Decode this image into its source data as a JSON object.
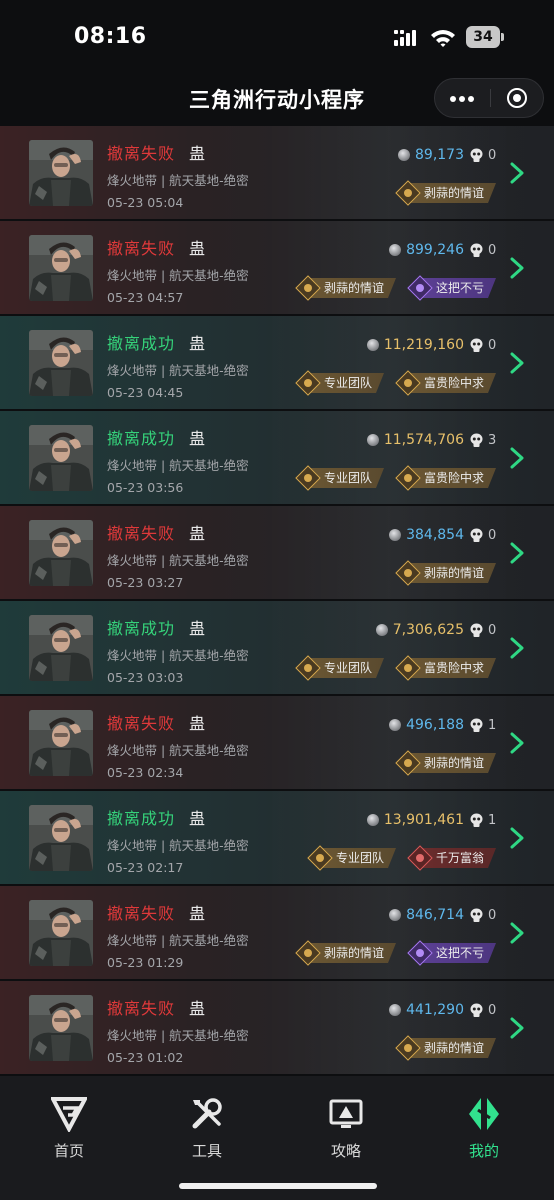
{
  "status_bar": {
    "time": "08:16",
    "battery": "34"
  },
  "nav": {
    "title": "三角洲行动小程序"
  },
  "icons": {
    "coin": "coin-icon",
    "kills": "skull-icon",
    "tag": "badge-diamond-icon",
    "row": "chevron-right-icon"
  },
  "colors": {
    "fail": "#e0393a",
    "success": "#35d27a",
    "value_blue": "#5fb8ec",
    "value_gold": "#e7c06a",
    "accent": "#32e28e"
  },
  "records": [
    {
      "status": "fail",
      "result": "撤离失败",
      "player": "蛊",
      "map": "烽火地带 | 航天基地-绝密",
      "time": "05-23 05:04",
      "value": "89,173",
      "value_color": "blue",
      "kills": "0",
      "tags": [
        {
          "label": "剥蒜的情谊",
          "style": "gold"
        }
      ]
    },
    {
      "status": "fail",
      "result": "撤离失败",
      "player": "蛊",
      "map": "烽火地带 | 航天基地-绝密",
      "time": "05-23 04:57",
      "value": "899,246",
      "value_color": "blue",
      "kills": "0",
      "tags": [
        {
          "label": "剥蒜的情谊",
          "style": "gold"
        },
        {
          "label": "这把不亏",
          "style": "purple"
        }
      ]
    },
    {
      "status": "success",
      "result": "撤离成功",
      "player": "蛊",
      "map": "烽火地带 | 航天基地-绝密",
      "time": "05-23 04:45",
      "value": "11,219,160",
      "value_color": "gold",
      "kills": "0",
      "tags": [
        {
          "label": "专业团队",
          "style": "gold"
        },
        {
          "label": "富贵险中求",
          "style": "gold"
        }
      ]
    },
    {
      "status": "success",
      "result": "撤离成功",
      "player": "蛊",
      "map": "烽火地带 | 航天基地-绝密",
      "time": "05-23 03:56",
      "value": "11,574,706",
      "value_color": "gold",
      "kills": "3",
      "tags": [
        {
          "label": "专业团队",
          "style": "gold"
        },
        {
          "label": "富贵险中求",
          "style": "gold"
        }
      ]
    },
    {
      "status": "fail",
      "result": "撤离失败",
      "player": "蛊",
      "map": "烽火地带 | 航天基地-绝密",
      "time": "05-23 03:27",
      "value": "384,854",
      "value_color": "blue",
      "kills": "0",
      "tags": [
        {
          "label": "剥蒜的情谊",
          "style": "gold"
        }
      ]
    },
    {
      "status": "success",
      "result": "撤离成功",
      "player": "蛊",
      "map": "烽火地带 | 航天基地-绝密",
      "time": "05-23 03:03",
      "value": "7,306,625",
      "value_color": "gold",
      "kills": "0",
      "tags": [
        {
          "label": "专业团队",
          "style": "gold"
        },
        {
          "label": "富贵险中求",
          "style": "gold"
        }
      ]
    },
    {
      "status": "fail",
      "result": "撤离失败",
      "player": "蛊",
      "map": "烽火地带 | 航天基地-绝密",
      "time": "05-23 02:34",
      "value": "496,188",
      "value_color": "blue",
      "kills": "1",
      "tags": [
        {
          "label": "剥蒜的情谊",
          "style": "gold"
        }
      ]
    },
    {
      "status": "success",
      "result": "撤离成功",
      "player": "蛊",
      "map": "烽火地带 | 航天基地-绝密",
      "time": "05-23 02:17",
      "value": "13,901,461",
      "value_color": "gold",
      "kills": "1",
      "tags": [
        {
          "label": "专业团队",
          "style": "gold"
        },
        {
          "label": "千万富翁",
          "style": "red"
        }
      ]
    },
    {
      "status": "fail",
      "result": "撤离失败",
      "player": "蛊",
      "map": "烽火地带 | 航天基地-绝密",
      "time": "05-23 01:29",
      "value": "846,714",
      "value_color": "blue",
      "kills": "0",
      "tags": [
        {
          "label": "剥蒜的情谊",
          "style": "gold"
        },
        {
          "label": "这把不亏",
          "style": "purple"
        }
      ]
    },
    {
      "status": "fail",
      "result": "撤离失败",
      "player": "蛊",
      "map": "烽火地带 | 航天基地-绝密",
      "time": "05-23 01:02",
      "value": "441,290",
      "value_color": "blue",
      "kills": "0",
      "tags": [
        {
          "label": "剥蒜的情谊",
          "style": "gold"
        }
      ]
    }
  ],
  "tabs": [
    {
      "label": "首页",
      "icon": "home-logo-icon",
      "active": false
    },
    {
      "label": "工具",
      "icon": "tools-icon",
      "active": false
    },
    {
      "label": "攻略",
      "icon": "guide-monitor-icon",
      "active": false
    },
    {
      "label": "我的",
      "icon": "mine-logo-icon",
      "active": true
    }
  ]
}
